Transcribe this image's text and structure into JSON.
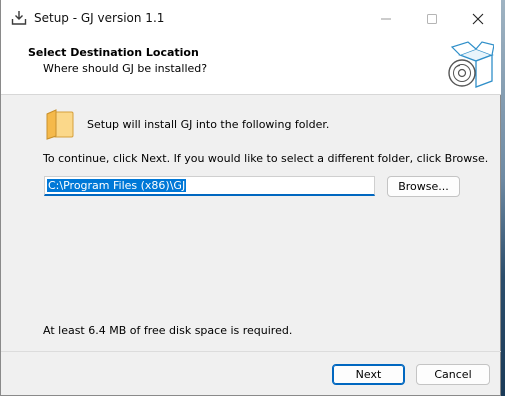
{
  "window": {
    "title": "Setup - GJ version 1.1",
    "controls": {
      "minimize": "—",
      "maximize": "☐",
      "close": "✕"
    }
  },
  "header": {
    "title": "Select Destination Location",
    "subtitle": "Where should GJ be installed?",
    "image_icon": "installer-box-cd-icon"
  },
  "body": {
    "folder_icon": "folder-icon",
    "intro": "Setup will install GJ into the following folder.",
    "instruction": "To continue, click Next. If you would like to select a different folder, click Browse.",
    "path_value": "C:\\Program Files (x86)\\GJ",
    "browse_label": "Browse...",
    "disk_space": "At least 6.4 MB of free disk space is required."
  },
  "footer": {
    "next_label": "Next",
    "cancel_label": "Cancel"
  },
  "colors": {
    "accent": "#0067c0",
    "selection": "#0078d7",
    "dialog_bg": "#f0f0f0",
    "header_bg": "#ffffff"
  }
}
